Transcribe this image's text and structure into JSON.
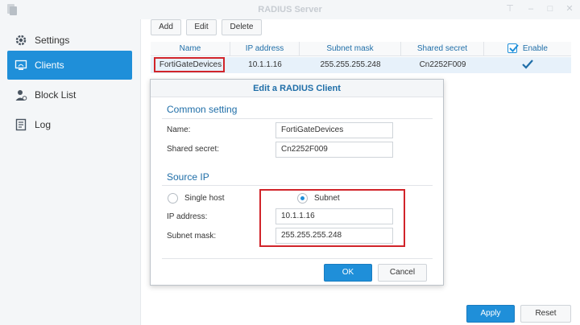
{
  "window": {
    "title": "RADIUS Server"
  },
  "sidebar": {
    "items": [
      {
        "label": "Settings",
        "icon": "gear-icon"
      },
      {
        "label": "Clients",
        "icon": "monitor-icon"
      },
      {
        "label": "Block List",
        "icon": "user-block-icon"
      },
      {
        "label": "Log",
        "icon": "log-icon"
      }
    ],
    "active": "Clients"
  },
  "toolbar": {
    "add_label": "Add",
    "edit_label": "Edit",
    "delete_label": "Delete"
  },
  "table": {
    "columns": [
      "Name",
      "IP address",
      "Subnet mask",
      "Shared secret",
      "Enable"
    ],
    "rows": [
      {
        "name": "FortiGateDevices",
        "ip": "10.1.1.16",
        "mask": "255.255.255.248",
        "secret": "Cn2252F009",
        "enabled": true
      }
    ]
  },
  "dialog": {
    "title": "Edit a RADIUS Client",
    "common_section": "Common setting",
    "name_label": "Name:",
    "name_value": "FortiGateDevices",
    "secret_label": "Shared secret:",
    "secret_value": "Cn2252F009",
    "source_section": "Source IP",
    "single_host_label": "Single host",
    "subnet_label": "Subnet",
    "selected_source": "Subnet",
    "ip_label": "IP address:",
    "ip_value": "10.1.1.16",
    "mask_label": "Subnet mask:",
    "mask_value": "255.255.255.248",
    "ok_label": "OK",
    "cancel_label": "Cancel"
  },
  "footer": {
    "apply_label": "Apply",
    "reset_label": "Reset"
  },
  "colors": {
    "accent": "#1f8fd9",
    "highlight": "#d1242a",
    "selected_row": "#e7f1fa"
  }
}
